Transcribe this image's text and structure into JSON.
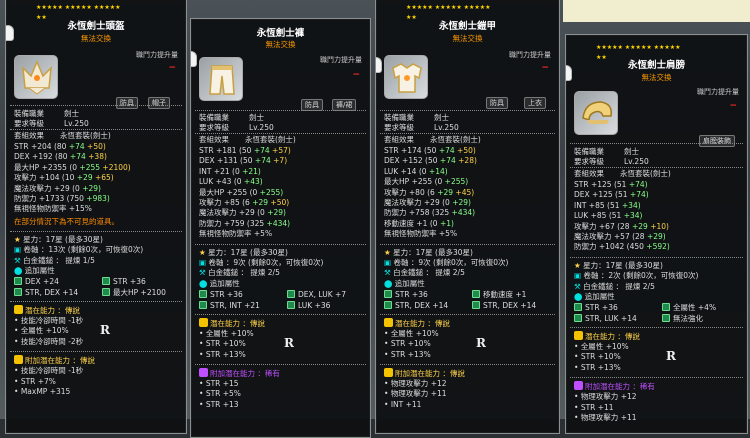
{
  "panels": [
    {
      "star_row1": "★★★★★ ★★★★★ ★★★★★",
      "star_row2": "★★",
      "name": "永恆劍士頭盔",
      "untradeable": "無法交換",
      "bonus_label": "職鬥力提升量",
      "minus": "−",
      "badge_a": "防具",
      "badge_b": "帽子",
      "job_label": "裝備職業",
      "job_value": "劍士",
      "req_label": "要求等級",
      "req_value": "Lv.250",
      "set_label": "套組效果",
      "set_value": "永恆套裝(劍士)",
      "stats": [
        [
          "STR",
          "+204",
          "(80",
          "+74",
          "+50)"
        ],
        [
          "DEX",
          "+192",
          "(80",
          "+74",
          "+38)"
        ],
        [
          "最大HP",
          "+2355",
          "(0",
          "+255",
          "+2100)"
        ],
        [
          "攻擊力",
          "+104",
          "(10",
          "+29",
          "+65)"
        ],
        [
          "魔法攻擊力",
          "+29",
          "(0",
          "+29)",
          ""
        ],
        [
          "防禦力",
          "+1733",
          "(750",
          "+983)",
          ""
        ],
        [
          "無視怪物防禦率",
          "+15%",
          "",
          "",
          ""
        ]
      ],
      "warning": "在部分情況下為不可見的道具。",
      "starforce": "星力：17星 (最多30星)",
      "scroll": "卷軸 ：13次 (剩餘0次，可恢復0次)",
      "platinum": "白金鐵鎚 ： 提煉 1/5",
      "extra_title": "追加屬性",
      "extras": [
        "DEX +24",
        "STR +36",
        "STR, DEX +14",
        "最大HP +2100"
      ],
      "potential_title": "潛在能力 ：傳說",
      "potentials": [
        "技能冷卻時間 -1秒",
        "全屬性 +10%",
        "技能冷卻時間 -2秒"
      ],
      "addpot_title": "附加潛在能力 ：傳說",
      "addpots": [
        "技能冷卻時間 -1秒",
        "STR +7%",
        "MaxMP +315"
      ],
      "rank_mark": "R"
    },
    {
      "star_row1": "★★★★★ ★★★★★ ★★★★★",
      "star_row2": "★★",
      "name": "永恆劍士褲",
      "untradeable": "無法交換",
      "bonus_label": "職鬥力提升量",
      "minus": "−",
      "badge_a": "防具",
      "badge_b": "褲/裙",
      "job_label": "裝備職業",
      "job_value": "劍士",
      "req_label": "要求等級",
      "req_value": "Lv.250",
      "set_label": "套組效果",
      "set_value": "永恆套裝(劍士)",
      "stats": [
        [
          "STR",
          "+181",
          "(50",
          "+74",
          "+57)"
        ],
        [
          "DEX",
          "+131",
          "(50",
          "+74",
          "+7)"
        ],
        [
          "INT",
          "+21",
          "(0",
          "+21)",
          ""
        ],
        [
          "LUK",
          "+43",
          "(0",
          "+43)",
          ""
        ],
        [
          "最大HP",
          "+255",
          "(0",
          "+255)",
          ""
        ],
        [
          "攻擊力",
          "+85",
          "(6",
          "+29",
          "+50)"
        ],
        [
          "魔法攻擊力",
          "+29",
          "(0",
          "+29)",
          ""
        ],
        [
          "防禦力",
          "+759",
          "(325",
          "+434)",
          ""
        ],
        [
          "無視怪物防禦率",
          "+5%",
          "",
          "",
          ""
        ]
      ],
      "starforce": "星力：17星 (最多30星)",
      "scroll": "卷軸 ：9次 (剩餘0次，可恢復0次)",
      "platinum": "白金鐵鎚 ： 提煉 2/5",
      "extra_title": "追加屬性",
      "extras": [
        "STR +36",
        "DEX, LUK +7",
        "STR, INT +21",
        "LUK +36"
      ],
      "potential_title": "潛在能力 ：傳說",
      "potentials": [
        "全屬性 +10%",
        "STR +10%",
        "STR +13%"
      ],
      "addpot_title": "附加潛在能力 ：稀有",
      "addpots": [
        "STR +15",
        "STR +5%",
        "STR +13"
      ],
      "rank_mark": "R"
    },
    {
      "star_row1": "★★★★★ ★★★★★ ★★★★★",
      "star_row2": "★★",
      "name": "永恆劍士鎧甲",
      "untradeable": "無法交換",
      "bonus_label": "職鬥力提升量",
      "minus": "−",
      "badge_a": "防具",
      "badge_b": "上衣",
      "job_label": "裝備職業",
      "job_value": "劍士",
      "req_label": "要求等級",
      "req_value": "Lv.250",
      "set_label": "套組效果",
      "set_value": "永恆套裝(劍士)",
      "stats": [
        [
          "STR",
          "+174",
          "(50",
          "+74",
          "+50)"
        ],
        [
          "DEX",
          "+152",
          "(50",
          "+74",
          "+28)"
        ],
        [
          "LUK",
          "+14",
          "(0",
          "+14)",
          ""
        ],
        [
          "最大HP",
          "+255",
          "(0",
          "+255)",
          ""
        ],
        [
          "攻擊力",
          "+80",
          "(6",
          "+29",
          "+45)"
        ],
        [
          "魔法攻擊力",
          "+29",
          "(0",
          "+29)",
          ""
        ],
        [
          "防禦力",
          "+758",
          "(325",
          "+434)",
          ""
        ],
        [
          "移動速度",
          "+1",
          "(0",
          "+1)",
          ""
        ],
        [
          "無視怪物防禦率",
          "+5%",
          "",
          "",
          ""
        ]
      ],
      "starforce": "星力：17星 (最多30星)",
      "scroll": "卷軸 ：9次 (剩餘0次，可恢復0次)",
      "platinum": "白金鐵鎚 ： 提煉 2/5",
      "extra_title": "追加屬性",
      "extras": [
        "STR +36",
        "移動速度 +1",
        "STR, DEX +14",
        "STR, DEX +14"
      ],
      "potential_title": "潛在能力 ：傳說",
      "potentials": [
        "全屬性 +10%",
        "STR +10%",
        "STR +13%"
      ],
      "addpot_title": "附加潛在能力 ：傳說",
      "addpots": [
        "物理攻擊力 +12",
        "物理攻擊力 +11",
        "INT +11"
      ],
      "rank_mark": "R"
    },
    {
      "star_row1": "★★★★★ ★★★★★ ★★★★★",
      "star_row2": "★★",
      "name": "永恆劍士肩膀",
      "untradeable": "無法交換",
      "bonus_label": "職鬥力提升量",
      "minus": "−",
      "badge_a": "肩膀裝飾",
      "job_label": "裝備職業",
      "job_value": "劍士",
      "req_label": "要求等級",
      "req_value": "Lv.250",
      "set_label": "套組效果",
      "set_value": "永恆套裝(劍士)",
      "stats": [
        [
          "STR",
          "+125",
          "(51",
          "+74)",
          ""
        ],
        [
          "DEX",
          "+125",
          "(51",
          "+74)",
          ""
        ],
        [
          "INT",
          "+85",
          "(51",
          "+34)",
          ""
        ],
        [
          "LUK",
          "+85",
          "(51",
          "+34)",
          ""
        ],
        [
          "攻擊力",
          "+67",
          "(28",
          "+29",
          "+10)"
        ],
        [
          "魔法攻擊力",
          "+57",
          "(28",
          "+29)",
          ""
        ],
        [
          "防禦力",
          "+1042",
          "(450",
          "+592)",
          ""
        ]
      ],
      "starforce": "星力：17星 (最多30星)",
      "scroll": "卷軸 ：2次 (剩餘0次，可恢復0次)",
      "platinum": "白金鐵鎚 ： 提煉 2/5",
      "extra_title": "追加屬性",
      "extras": [
        "STR +36",
        "全屬性 +4%",
        "STR, LUK +14",
        "無法強化"
      ],
      "potential_title": "潛在能力 ：傳說",
      "potentials": [
        "全屬性 +10%",
        "STR +10%",
        "STR +13%"
      ],
      "addpot_title": "附加潛在能力 ：稀有",
      "addpots": [
        "物理攻擊力 +12",
        "STR +11",
        "物理攻擊力 +11"
      ],
      "rank_mark": "R"
    }
  ],
  "colors": {
    "gold": "#ffd24a",
    "green": "#8aff8a",
    "orange": "#ff8c00",
    "cyan": "#00e0e0",
    "legend_yellow": "#f3c200",
    "rare_purple": "#c050ff"
  }
}
